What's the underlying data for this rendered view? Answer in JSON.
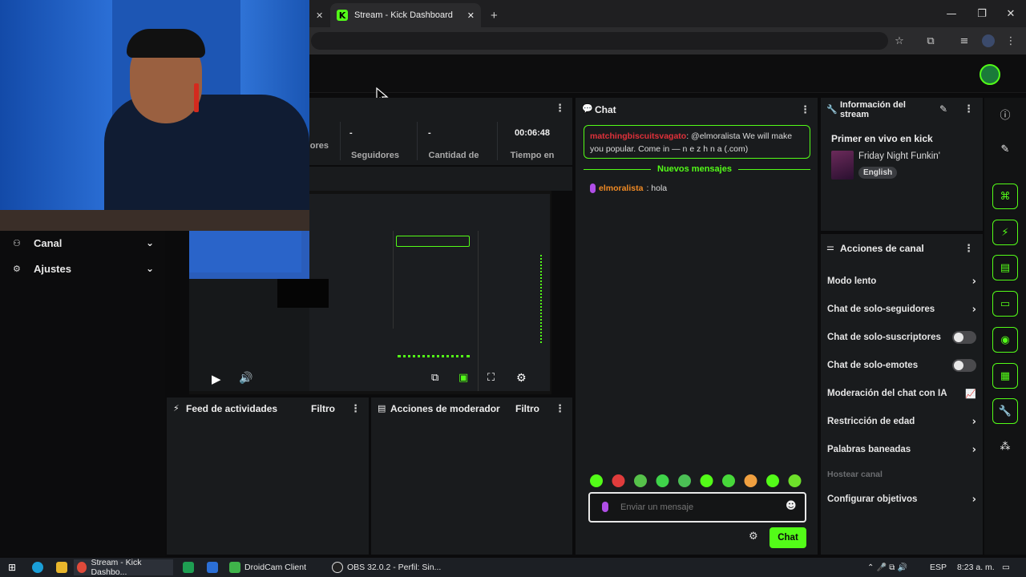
{
  "browser": {
    "tabs": [
      {
        "label": ""
      },
      {
        "label": "Stream - Kick Dashboard"
      }
    ],
    "new_tab": "+",
    "window_controls": {
      "minimize": "—",
      "maximize": "❐",
      "close": "✕"
    }
  },
  "stats": [
    {
      "value": "",
      "label": "ores"
    },
    {
      "value": "-",
      "label": "Seguidores"
    },
    {
      "value": "-",
      "label": "Cantidad de"
    },
    {
      "value": "00:06:48",
      "label": "Tiempo en"
    }
  ],
  "sidebar": {
    "items": [
      {
        "label": "Canal",
        "icon": "users-icon"
      },
      {
        "label": "Ajustes",
        "icon": "gear-icon"
      }
    ]
  },
  "chat": {
    "title": "Chat",
    "pinned": {
      "user": "matchingbiscuitsvagato",
      "text": ": @elmoralista We will make you popular. Come in — n e z h n a (.com)"
    },
    "divider": "Nuevos mensajes",
    "messages": [
      {
        "user": "elmoralista",
        "text": ": hola"
      }
    ],
    "placeholder": "Enviar un mensaje",
    "send_label": "Chat",
    "emote_colors": [
      "#53fc18",
      "#e03c3c",
      "#56c24a",
      "#3fd44a",
      "#4bbf55",
      "#53fc18",
      "#47d83a",
      "#f0a040",
      "#53fc18",
      "#6ee02a"
    ]
  },
  "stream_info": {
    "title": "Información del stream",
    "stream_title": "Primer en vivo en kick",
    "category": "Friday Night Funkin'",
    "language": "English"
  },
  "channel_actions": {
    "title": "Acciones de canal",
    "rows": [
      {
        "label": "Modo lento",
        "control": "chevron"
      },
      {
        "label": "Chat de solo-seguidores",
        "control": "chevron"
      },
      {
        "label": "Chat de solo-suscriptores",
        "control": "toggle",
        "on": false
      },
      {
        "label": "Chat de solo-emotes",
        "control": "toggle",
        "on": false
      },
      {
        "label": "Moderación del chat con IA",
        "control": "chart"
      },
      {
        "label": "Restricción de edad",
        "control": "chevron"
      },
      {
        "label": "Palabras baneadas",
        "control": "chevron"
      },
      {
        "label": "Hostear canal",
        "control": "none",
        "disabled": true
      },
      {
        "label": "Configurar objetivos",
        "control": "chevron"
      }
    ]
  },
  "activity_feed": {
    "title": "Feed de actividades",
    "filter": "Filtro"
  },
  "mod_actions": {
    "title": "Acciones de moderador",
    "filter": "Filtro"
  },
  "taskbar": {
    "apps": [
      {
        "label": "Stream - Kick Dashbo..."
      },
      {
        "label": "DroidCam Client"
      },
      {
        "label": "OBS 32.0.2 - Perfil: Sin..."
      }
    ],
    "lang": "ESP",
    "time": "8:23 a. m."
  },
  "colors": {
    "accent": "#53fc18",
    "panel": "#191b1d",
    "bg": "#0b0b0c"
  }
}
